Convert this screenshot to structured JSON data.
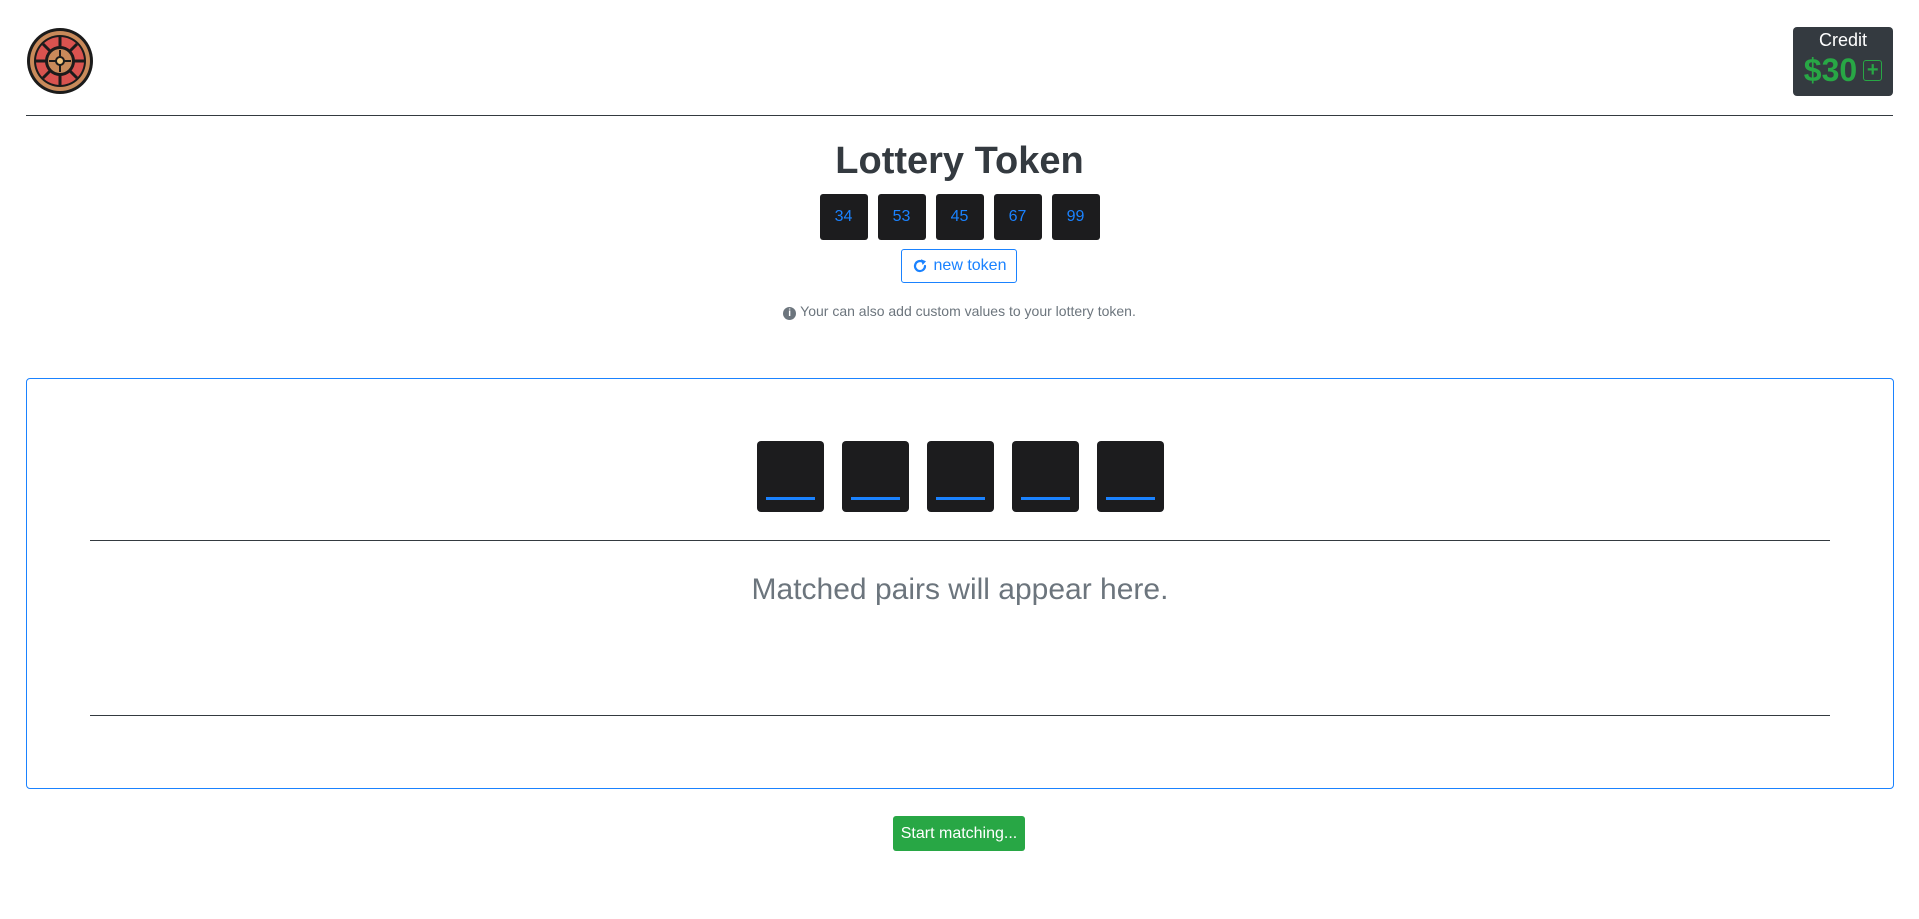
{
  "header": {
    "logo_icon": "roulette-wheel-icon",
    "credit_label": "Credit",
    "credit_amount": "$30",
    "add_credit_symbol": "+"
  },
  "lottery": {
    "title": "Lottery Token",
    "numbers": [
      "34",
      "53",
      "45",
      "67",
      "99"
    ],
    "new_token_label": "new token",
    "new_token_icon": "refresh-icon",
    "hint_icon": "info-icon",
    "hint": "Your can also add custom values to your lottery token."
  },
  "match": {
    "slot_count": 5,
    "placeholder": "Matched pairs will appear here.",
    "start_label": "Start matching..."
  },
  "colors": {
    "primary": "#1a82ff",
    "success": "#28a745",
    "dark": "#343a40",
    "token_bg": "#1c1c1e",
    "muted": "#6c757d"
  }
}
